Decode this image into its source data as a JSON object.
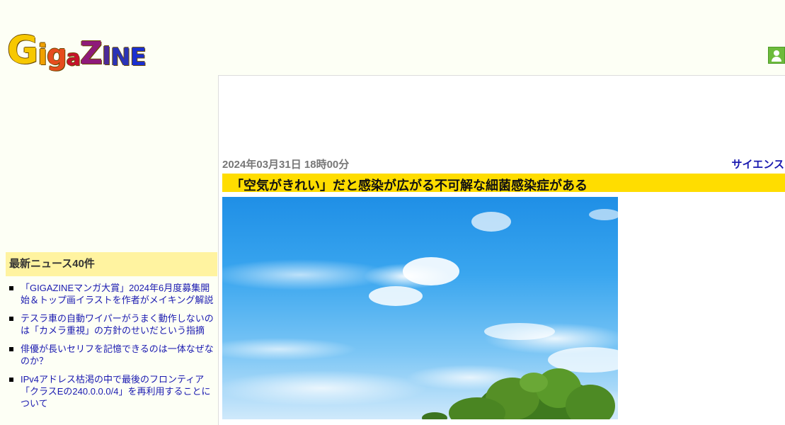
{
  "logo": {
    "letters": [
      "G",
      "i",
      "g",
      "a",
      "Z",
      "I",
      "N",
      "E"
    ]
  },
  "article": {
    "date": "2024年03月31日 18時00分",
    "category": "サイエンス",
    "headline": "「空気がきれい」だと感染が広がる不可解な細菌感染症がある"
  },
  "sidebar": {
    "title": "最新ニュース40件",
    "items": [
      {
        "label": "「GIGAZINEマンガ大賞」2024年6月度募集開始＆トップ画イラストを作者がメイキング解説"
      },
      {
        "label": "テスラ車の自動ワイパーがうまく動作しないのは「カメラ重視」の方針のせいだという指摘"
      },
      {
        "label": "俳優が長いセリフを記憶できるのは一体なぜなのか？"
      },
      {
        "label": "IPv4アドレス枯渇の中で最後のフロンティア「クラスEの240.0.0.0/4」を再利用することについて"
      }
    ]
  },
  "colors": {
    "headline_bg": "#ffdd00",
    "sidebar_title_bg": "#fff3a0",
    "link": "#1a1ab0",
    "page_bg": "#fdfff5"
  },
  "icons": {
    "user": "user-icon"
  }
}
